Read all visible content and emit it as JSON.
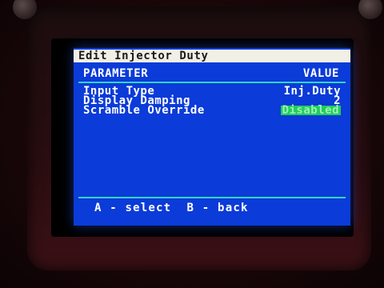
{
  "screen": {
    "title": "Edit Injector Duty",
    "header": {
      "parameter": "PARAMETER",
      "value": "VALUE"
    },
    "rows": [
      {
        "label": "Input Type",
        "value": "Inj.Duty"
      },
      {
        "label": "Display Damping",
        "value": "2"
      },
      {
        "label": "Scramble Override",
        "value": "Disabled"
      }
    ],
    "footer": "A - select  B - back"
  },
  "colors": {
    "screen_bg": "#0b3bd8",
    "title_bg": "#f2efe6",
    "rule": "#31d4c9",
    "highlight": "#1fcf5a"
  }
}
